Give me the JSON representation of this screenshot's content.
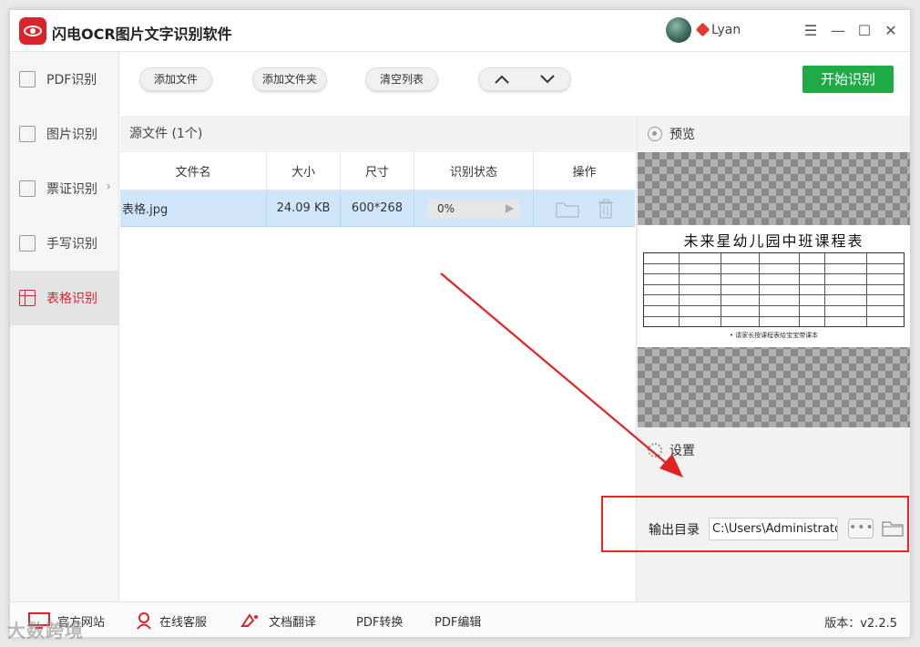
{
  "app": {
    "title": "闪电OCR图片文字识别软件",
    "username": "Lyan"
  },
  "window_controls": {
    "menu": "☰",
    "minimize": "—",
    "maximize": "☐",
    "close": "✕"
  },
  "sidebar": {
    "items": [
      {
        "label": "PDF识别",
        "icon": "pdf-icon"
      },
      {
        "label": "图片识别",
        "icon": "image-icon"
      },
      {
        "label": "票证识别",
        "icon": "ticket-icon"
      },
      {
        "label": "手写识别",
        "icon": "handwriting-icon"
      },
      {
        "label": "表格识别",
        "icon": "table-icon",
        "active": true
      }
    ]
  },
  "toolbar": {
    "add_file": "添加文件",
    "add_folder": "添加文件夹",
    "clear_list": "清空列表",
    "start": "开始识别"
  },
  "file_list": {
    "header": "源文件 (1个)",
    "columns": [
      "文件名",
      "大小",
      "尺寸",
      "识别状态",
      "操作"
    ],
    "rows": [
      {
        "name": "表格.jpg",
        "size": "24.09 KB",
        "dimensions": "600*268",
        "status": "0%",
        "progress": 0
      }
    ]
  },
  "preview": {
    "label": "预览",
    "image_title": "未来星幼儿园中班课程表",
    "image_note": "• 请家长按课程表给宝宝带课本"
  },
  "settings": {
    "label": "设置",
    "output_label": "输出目录",
    "output_path": "C:\\Users\\Administrator\\"
  },
  "bottom": {
    "website": "官方网站",
    "support": "在线客服",
    "translate": "文档翻译",
    "pdf_convert": "PDF转换",
    "pdf_edit": "PDF编辑",
    "version": "版本：v2.2.5"
  },
  "watermark": "大数跨境",
  "colors": {
    "brand_red": "#d9242b",
    "start_green": "#1faa48",
    "row_selected": "#cfe6fa",
    "highlight_red": "#e22222"
  }
}
